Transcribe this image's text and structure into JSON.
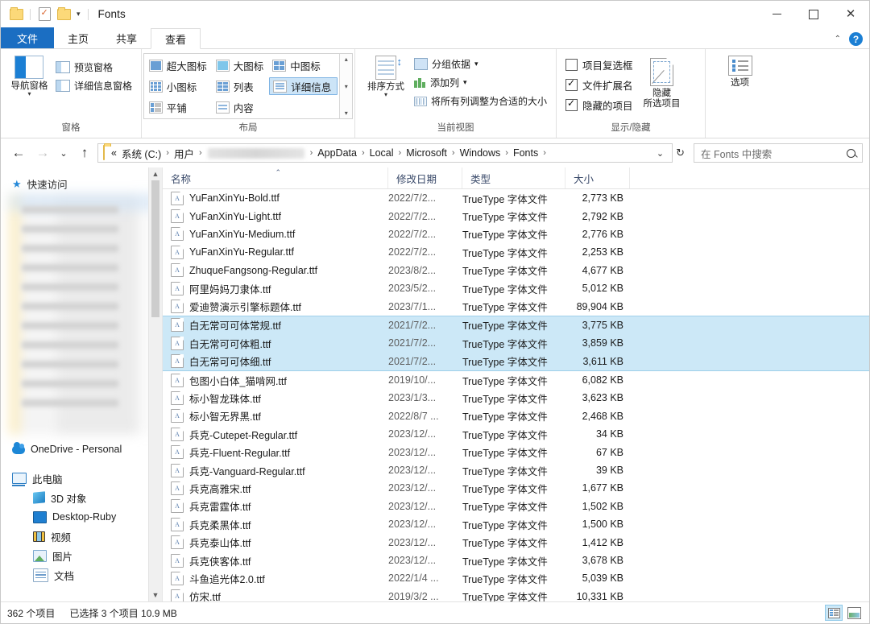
{
  "window": {
    "title": "Fonts",
    "quick_access": [
      "folder-icon",
      "properties-icon",
      "new-folder-icon",
      "customize-caret"
    ],
    "controls": {
      "minimize": "–",
      "maximize": "□",
      "close": "✕"
    }
  },
  "ribbon": {
    "tabs": [
      {
        "label": "文件",
        "type": "file"
      },
      {
        "label": "主页",
        "type": "normal"
      },
      {
        "label": "共享",
        "type": "normal"
      },
      {
        "label": "查看",
        "type": "active"
      }
    ],
    "collapse_label": "⌃",
    "help_label": "?",
    "groups": [
      {
        "name": "窗格",
        "big_button": {
          "label": "导航窗格",
          "caret": "▾"
        },
        "small_buttons": [
          {
            "label": "预览窗格"
          },
          {
            "label": "详细信息窗格"
          }
        ]
      },
      {
        "name": "布局",
        "items": [
          {
            "label": "超大图标",
            "selected": false
          },
          {
            "label": "大图标",
            "selected": false
          },
          {
            "label": "中图标",
            "selected": false
          },
          {
            "label": "小图标",
            "selected": false
          },
          {
            "label": "列表",
            "selected": false
          },
          {
            "label": "详细信息",
            "selected": true
          },
          {
            "label": "平铺",
            "selected": false
          },
          {
            "label": "内容",
            "selected": false
          }
        ],
        "scroll": {
          "up": "▴",
          "down": "▾",
          "more": "▾"
        }
      },
      {
        "name": "当前视图",
        "big_button": {
          "label": "排序方式",
          "caret": "▾"
        },
        "small_buttons": [
          {
            "label": "分组依据",
            "caret": "▾"
          },
          {
            "label": "添加列",
            "caret": "▾"
          },
          {
            "label": "将所有列调整为合适的大小",
            "caret": ""
          }
        ]
      },
      {
        "name": "显示/隐藏",
        "checkboxes": [
          {
            "label": "项目复选框",
            "checked": false
          },
          {
            "label": "文件扩展名",
            "checked": true
          },
          {
            "label": "隐藏的项目",
            "checked": true
          }
        ],
        "hide_button": {
          "line1": "隐藏",
          "line2": "所选项目"
        }
      },
      {
        "name": "",
        "options_button": {
          "label": "选项"
        }
      }
    ]
  },
  "address": {
    "back": "←",
    "forward": "→",
    "history": "⌄",
    "up": "↑",
    "crumbs": [
      {
        "label": "«",
        "type": "overflow"
      },
      {
        "label": "系统 (C:)",
        "type": "text"
      },
      {
        "label": "用户",
        "type": "text"
      },
      {
        "label": "",
        "type": "blurred"
      },
      {
        "label": "AppData",
        "type": "text"
      },
      {
        "label": "Local",
        "type": "text"
      },
      {
        "label": "Microsoft",
        "type": "text"
      },
      {
        "label": "Windows",
        "type": "text"
      },
      {
        "label": "Fonts",
        "type": "text"
      }
    ],
    "separator": "›",
    "dropdown_caret": "⌄",
    "refresh": "↻",
    "search_placeholder": "在 Fonts 中搜索"
  },
  "sidebar": {
    "items": [
      {
        "label": "快速访问",
        "icon": "star-icon",
        "level": "root"
      },
      {
        "label": "OneDrive - Personal",
        "icon": "cloud-icon",
        "level": "root"
      },
      {
        "label": "此电脑",
        "icon": "pc-icon",
        "level": "root"
      },
      {
        "label": "3D 对象",
        "icon": "3d-objects-icon",
        "level": "indent"
      },
      {
        "label": "Desktop-Ruby",
        "icon": "desktop-icon",
        "level": "indent"
      },
      {
        "label": "视频",
        "icon": "videos-icon",
        "level": "indent"
      },
      {
        "label": "图片",
        "icon": "pictures-icon",
        "level": "indent"
      },
      {
        "label": "文档",
        "icon": "documents-icon",
        "level": "indent"
      }
    ]
  },
  "filelist": {
    "columns": [
      {
        "key": "name",
        "label": "名称",
        "sorted": true,
        "sort_caret": "⌃"
      },
      {
        "key": "date",
        "label": "修改日期"
      },
      {
        "key": "type",
        "label": "类型"
      },
      {
        "key": "size",
        "label": "大小"
      }
    ],
    "rows": [
      {
        "name": "YuFanXinYu-Bold.ttf",
        "date": "2022/7/2...",
        "type": "TrueType 字体文件",
        "size": "2,773 KB",
        "selected": false
      },
      {
        "name": "YuFanXinYu-Light.ttf",
        "date": "2022/7/2...",
        "type": "TrueType 字体文件",
        "size": "2,792 KB",
        "selected": false
      },
      {
        "name": "YuFanXinYu-Medium.ttf",
        "date": "2022/7/2...",
        "type": "TrueType 字体文件",
        "size": "2,776 KB",
        "selected": false
      },
      {
        "name": "YuFanXinYu-Regular.ttf",
        "date": "2022/7/2...",
        "type": "TrueType 字体文件",
        "size": "2,253 KB",
        "selected": false
      },
      {
        "name": "ZhuqueFangsong-Regular.ttf",
        "date": "2023/8/2...",
        "type": "TrueType 字体文件",
        "size": "4,677 KB",
        "selected": false
      },
      {
        "name": "阿里妈妈刀隶体.ttf",
        "date": "2023/5/2...",
        "type": "TrueType 字体文件",
        "size": "5,012 KB",
        "selected": false
      },
      {
        "name": "爱迪赞演示引擎标题体.ttf",
        "date": "2023/7/1...",
        "type": "TrueType 字体文件",
        "size": "89,904 KB",
        "selected": false
      },
      {
        "name": "白无常可可体常规.ttf",
        "date": "2021/7/2...",
        "type": "TrueType 字体文件",
        "size": "3,775 KB",
        "selected": true
      },
      {
        "name": "白无常可可体粗.ttf",
        "date": "2021/7/2...",
        "type": "TrueType 字体文件",
        "size": "3,859 KB",
        "selected": true
      },
      {
        "name": "白无常可可体细.ttf",
        "date": "2021/7/2...",
        "type": "TrueType 字体文件",
        "size": "3,611 KB",
        "selected": true
      },
      {
        "name": "包图小白体_猫啃网.ttf",
        "date": "2019/10/...",
        "type": "TrueType 字体文件",
        "size": "6,082 KB",
        "selected": false
      },
      {
        "name": "标小智龙珠体.ttf",
        "date": "2023/1/3...",
        "type": "TrueType 字体文件",
        "size": "3,623 KB",
        "selected": false
      },
      {
        "name": "标小智无界黑.ttf",
        "date": "2022/8/7 ...",
        "type": "TrueType 字体文件",
        "size": "2,468 KB",
        "selected": false
      },
      {
        "name": "兵克-Cutepet-Regular.ttf",
        "date": "2023/12/...",
        "type": "TrueType 字体文件",
        "size": "34 KB",
        "selected": false
      },
      {
        "name": "兵克-Fluent-Regular.ttf",
        "date": "2023/12/...",
        "type": "TrueType 字体文件",
        "size": "67 KB",
        "selected": false
      },
      {
        "name": "兵克-Vanguard-Regular.ttf",
        "date": "2023/12/...",
        "type": "TrueType 字体文件",
        "size": "39 KB",
        "selected": false
      },
      {
        "name": "兵克高雅宋.ttf",
        "date": "2023/12/...",
        "type": "TrueType 字体文件",
        "size": "1,677 KB",
        "selected": false
      },
      {
        "name": "兵克雷霆体.ttf",
        "date": "2023/12/...",
        "type": "TrueType 字体文件",
        "size": "1,502 KB",
        "selected": false
      },
      {
        "name": "兵克柔黑体.ttf",
        "date": "2023/12/...",
        "type": "TrueType 字体文件",
        "size": "1,500 KB",
        "selected": false
      },
      {
        "name": "兵克泰山体.ttf",
        "date": "2023/12/...",
        "type": "TrueType 字体文件",
        "size": "1,412 KB",
        "selected": false
      },
      {
        "name": "兵克侠客体.ttf",
        "date": "2023/12/...",
        "type": "TrueType 字体文件",
        "size": "3,678 KB",
        "selected": false
      },
      {
        "name": "斗鱼追光体2.0.ttf",
        "date": "2022/1/4 ...",
        "type": "TrueType 字体文件",
        "size": "5,039 KB",
        "selected": false
      },
      {
        "name": "仿宋.ttf",
        "date": "2019/3/2 ...",
        "type": "TrueType 字体文件",
        "size": "10,331 KB",
        "selected": false
      }
    ]
  },
  "status": {
    "item_count": "362 个项目",
    "selection": "已选择 3 个项目  10.9 MB",
    "views": [
      {
        "name": "details-view",
        "active": true
      },
      {
        "name": "large-icons-view",
        "active": false
      }
    ]
  },
  "colors": {
    "accent": "#1b6ec2",
    "selection": "#cce8f7",
    "selection_border": "#9fd0ea",
    "folder": "#fcd979"
  }
}
